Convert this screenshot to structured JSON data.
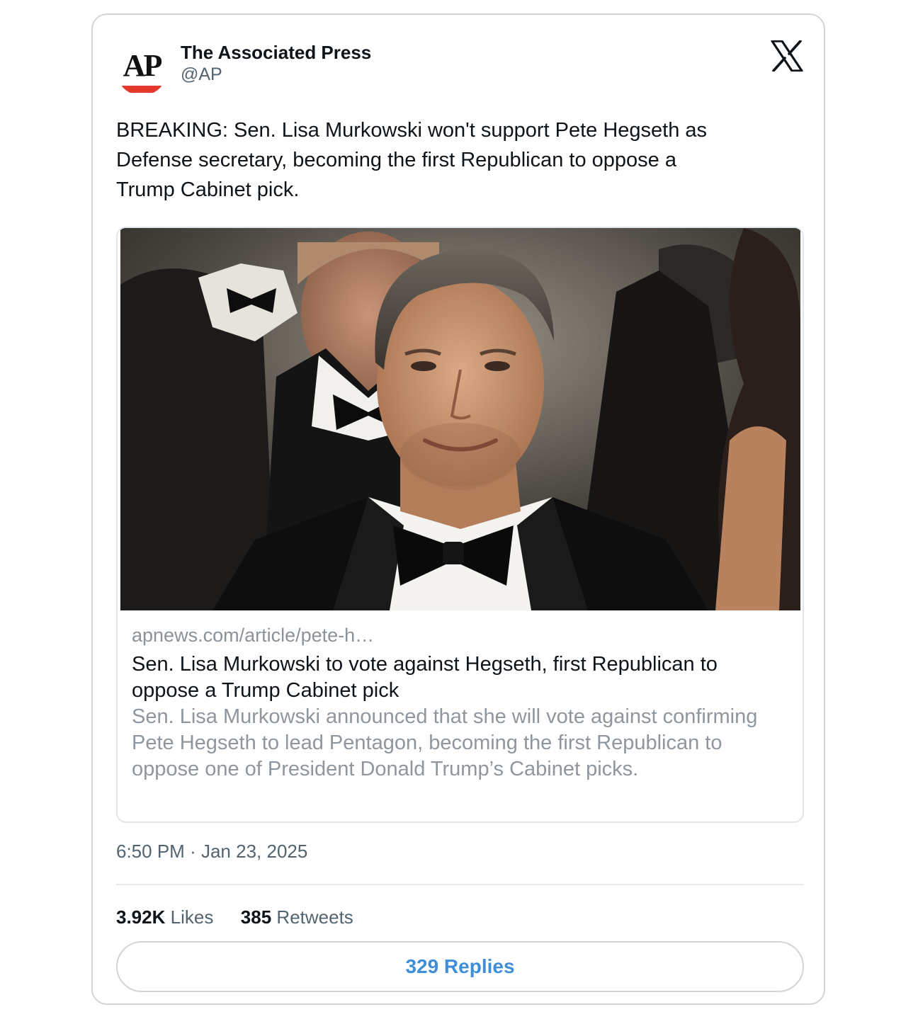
{
  "author": {
    "name": "The Associated Press",
    "handle": "@AP",
    "avatar_text": "AP",
    "avatar_accent": "#e2392c"
  },
  "platform_icon": "x-logo-icon",
  "tweet": {
    "text": "BREAKING: Sen. Lisa Murkowski won't support Pete Hegseth as\nDefense secretary, becoming the first Republican to oppose a\nTrump Cabinet pick.",
    "time": "6:50 PM",
    "separator": "·",
    "date": "Jan 23, 2025"
  },
  "link_card": {
    "domain": "apnews.com/article/pete-h…",
    "title": "Sen. Lisa Murkowski to vote against Hegseth, first Republican to oppose a Trump Cabinet pick",
    "description": "Sen. Lisa Murkowski announced that she will vote against confirming Pete Hegseth to lead Pentagon, becoming the first Republican to oppose one of President Donald Trump’s Cabinet picks."
  },
  "stats": {
    "likes_count": "3.92K",
    "likes_label": "Likes",
    "retweets_count": "385",
    "retweets_label": "Retweets"
  },
  "replies_button": {
    "label": "329 Replies"
  },
  "colors": {
    "text_primary": "#0f1419",
    "text_secondary": "#536471",
    "link_blue": "#3f8fd8",
    "border": "#d0d5d9"
  }
}
